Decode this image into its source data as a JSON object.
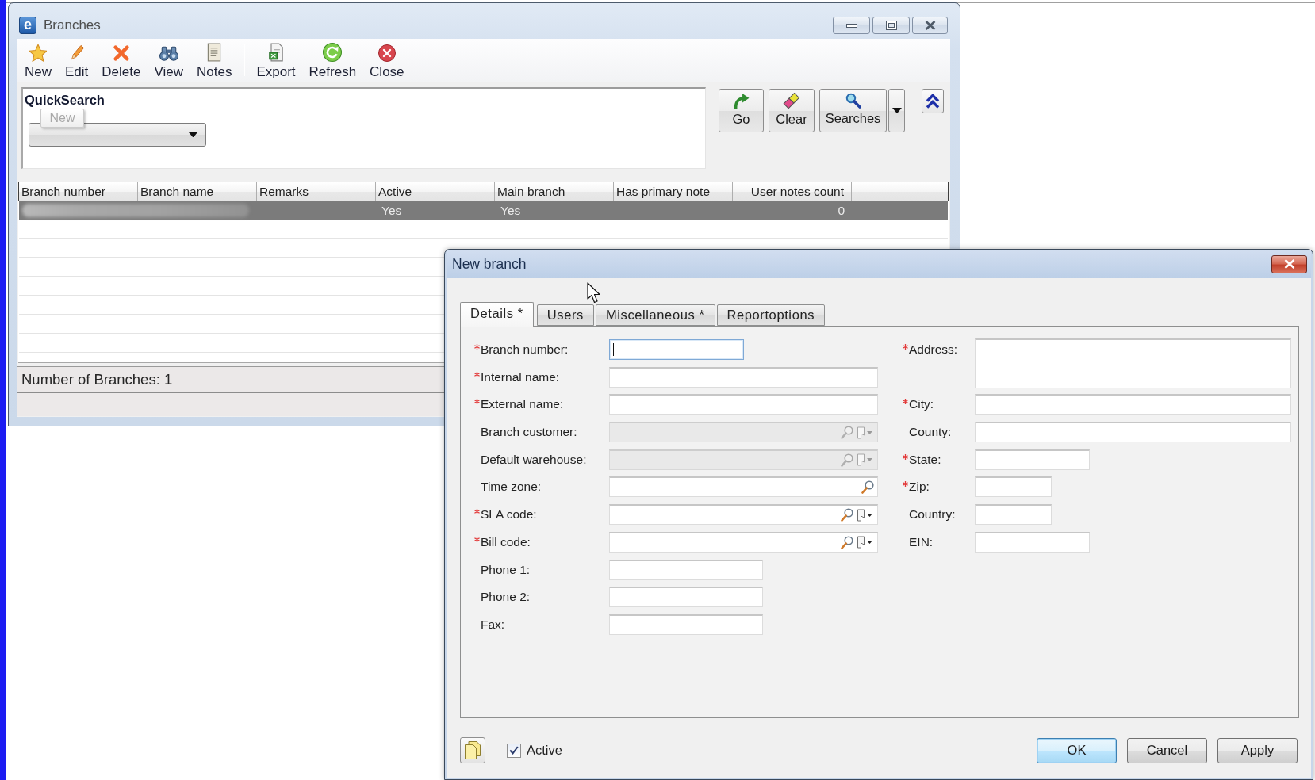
{
  "branches_window": {
    "title_icon": "e",
    "title": "Branches",
    "toolbar_groups": [
      {
        "buttons": [
          {
            "label": "New"
          },
          {
            "label": "Edit"
          },
          {
            "label": "Delete"
          },
          {
            "label": "View"
          },
          {
            "label": "Notes"
          }
        ]
      },
      {
        "buttons": [
          {
            "label": "Export"
          },
          {
            "label": "Refresh"
          },
          {
            "label": "Close"
          }
        ]
      }
    ],
    "quicksearch": {
      "label": "QuickSearch",
      "tooltip": "New"
    },
    "search_buttons": [
      {
        "label": "Go",
        "kind": "plain"
      },
      {
        "label": "Clear",
        "kind": "plain"
      },
      {
        "label": "Searches",
        "kind": "split"
      }
    ],
    "table": {
      "columns": [
        "Branch number",
        "Branch name",
        "Remarks",
        "Active",
        "Main branch",
        "Has primary note",
        "User notes count"
      ],
      "rows": [
        {
          "selected": true,
          "blurred": true,
          "active": "Yes",
          "main_branch": "Yes",
          "user_notes_count": "0"
        }
      ]
    },
    "status": "Number of Branches: 1"
  },
  "dialog": {
    "title": "New branch",
    "tabs": [
      {
        "label": "Details *",
        "selected": true
      },
      {
        "label": "Users",
        "selected": false
      },
      {
        "label": "Miscellaneous *",
        "selected": false
      },
      {
        "label": "Reportoptions",
        "selected": false
      }
    ],
    "left_fields": [
      {
        "label": "Branch number:",
        "required": true,
        "kind": "text",
        "focused": true,
        "disabled": false
      },
      {
        "label": "Internal name:",
        "required": true,
        "kind": "text",
        "focused": false,
        "disabled": false
      },
      {
        "label": "External name:",
        "required": true,
        "kind": "text",
        "focused": false,
        "disabled": false
      },
      {
        "label": "Branch customer:",
        "required": false,
        "kind": "lookup",
        "focused": false,
        "disabled": true
      },
      {
        "label": "Default warehouse:",
        "required": false,
        "kind": "lookup",
        "focused": false,
        "disabled": true
      },
      {
        "label": "Time zone:",
        "required": false,
        "kind": "search",
        "focused": false,
        "disabled": false
      },
      {
        "label": "SLA code:",
        "required": true,
        "kind": "lookup",
        "focused": false,
        "disabled": false
      },
      {
        "label": "Bill code:",
        "required": true,
        "kind": "lookup",
        "focused": false,
        "disabled": false
      },
      {
        "label": "Phone 1:",
        "required": false,
        "kind": "text",
        "focused": false,
        "disabled": false
      },
      {
        "label": "Phone 2:",
        "required": false,
        "kind": "text",
        "focused": false,
        "disabled": false
      },
      {
        "label": "Fax:",
        "required": false,
        "kind": "text",
        "focused": false,
        "disabled": false
      }
    ],
    "right_fields": [
      {
        "label": "Address:",
        "required": true,
        "kind": "multiline"
      },
      {
        "label": "City:",
        "required": true,
        "kind": "text"
      },
      {
        "label": "County:",
        "required": false,
        "kind": "text"
      },
      {
        "label": "State:",
        "required": true,
        "kind": "text"
      },
      {
        "label": "Zip:",
        "required": true,
        "kind": "text"
      },
      {
        "label": "Country:",
        "required": false,
        "kind": "text"
      },
      {
        "label": "EIN:",
        "required": false,
        "kind": "text"
      }
    ],
    "active": {
      "label": "Active",
      "checked": true
    },
    "buttons": [
      {
        "label": "OK",
        "default": true
      },
      {
        "label": "Cancel",
        "default": false
      },
      {
        "label": "Apply",
        "default": false
      }
    ]
  }
}
